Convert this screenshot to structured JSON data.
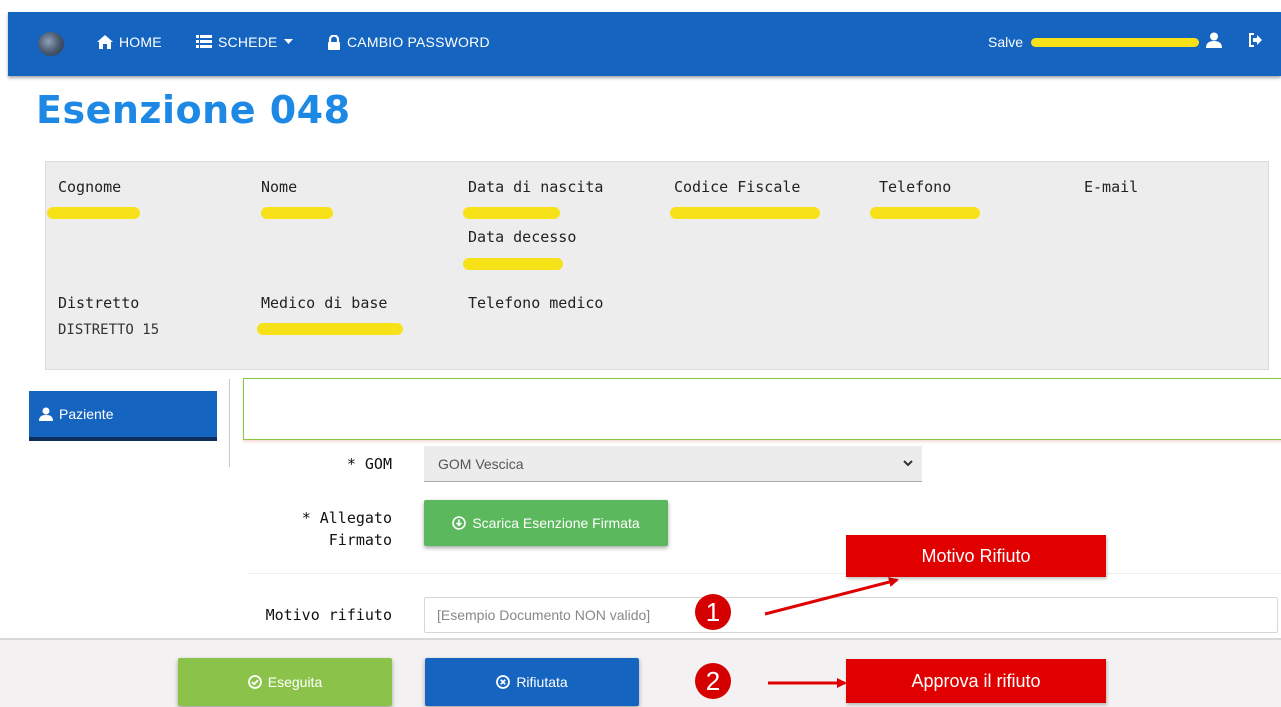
{
  "navbar": {
    "home_label": "HOME",
    "schede_label": "SCHEDE",
    "password_label": "CAMBIO PASSWORD",
    "greeting": "Salve",
    "colors": {
      "bar": "#1565c0",
      "text": "#ffffff"
    }
  },
  "page": {
    "title": "Esenzione 048",
    "title_color": "#1e88e5"
  },
  "patient": {
    "cognome_label": "Cognome",
    "nome_label": "Nome",
    "nascita_label": "Data di nascita",
    "codice_fiscale_label": "Codice Fiscale",
    "telefono_label": "Telefono",
    "email_label": "E-mail",
    "decesso_label": "Data decesso",
    "distretto_label": "Distretto",
    "distretto_value": "DISTRETTO 15",
    "medico_label": "Medico di base",
    "telefono_medico_label": "Telefono medico"
  },
  "sidebar": {
    "tab_label": "Paziente"
  },
  "form": {
    "gom_label": "* GOM",
    "gom_value": "GOM Vescica",
    "allegato_label_1": "* Allegato",
    "allegato_label_2": "Firmato",
    "download_button": "Scarica Esenzione Firmata",
    "motivo_label": "Motivo rifiuto",
    "motivo_value": "[Esempio Documento NON valido]"
  },
  "footer": {
    "eseguita_label": "Eseguita",
    "rifiutata_label": "Rifiutata",
    "colors": {
      "eseguita": "#8bc34a",
      "rifiutata": "#1565c0"
    }
  },
  "annotations": {
    "callout_1": "Motivo Rifiuto",
    "callout_2": "Approva il rifiuto",
    "badge_1": "1",
    "badge_2": "2",
    "color": "#e00000"
  },
  "icons": [
    "logo-icon",
    "home-icon",
    "list-icon",
    "caret-down-icon",
    "lock-icon",
    "user-icon",
    "logout-icon",
    "chevron-down-icon",
    "download-circle-icon",
    "check-circle-icon",
    "close-circle-icon"
  ]
}
